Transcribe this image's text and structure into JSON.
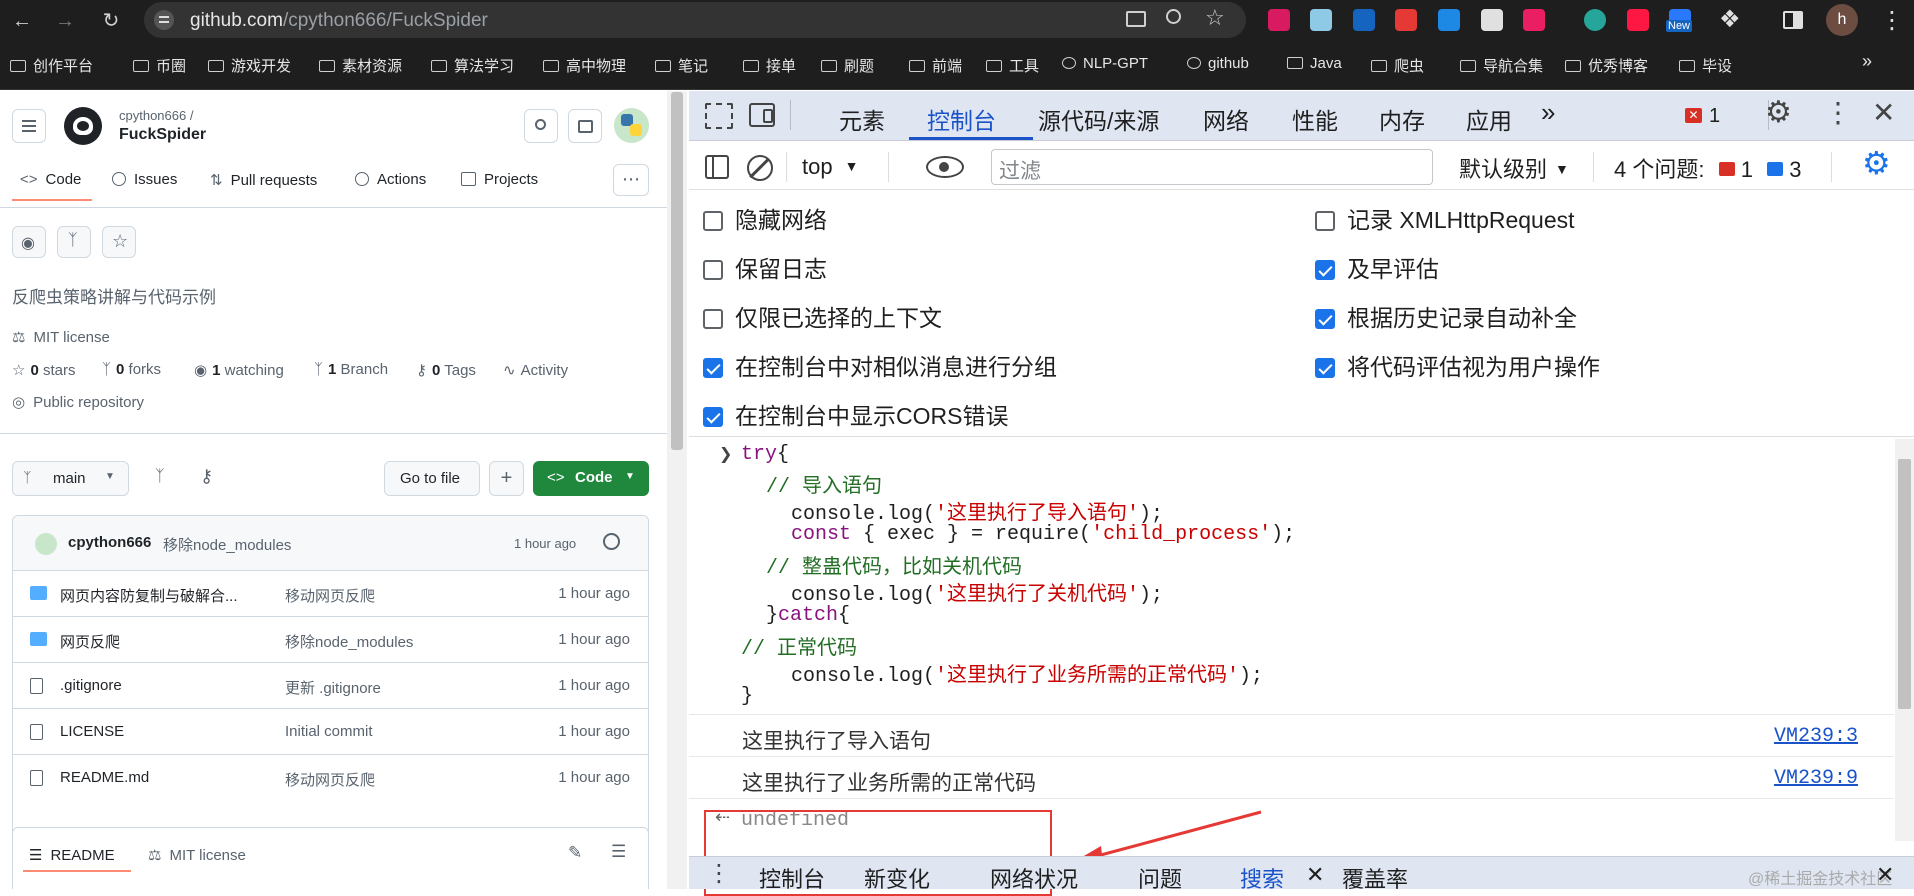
{
  "browser": {
    "url_host": "github.com",
    "url_path": "/cpython666/FuckSpider",
    "profile_initial": "h",
    "ext_new_badge": "New",
    "bookmarks": [
      "创作平台",
      "币圈",
      "游戏开发",
      "素材资源",
      "算法学习",
      "高中物理",
      "笔记",
      "接单",
      "刷题",
      "前端",
      "工具",
      "NLP-GPT",
      "github",
      "Java",
      "爬虫",
      "导航合集",
      "优秀博客",
      "毕设"
    ]
  },
  "github": {
    "owner": "cpython666 /",
    "repo": "FuckSpider",
    "tabs": [
      "Code",
      "Issues",
      "Pull requests",
      "Actions",
      "Projects"
    ],
    "description": "反爬虫策略讲解与代码示例",
    "license": "MIT license",
    "stars": "0",
    "stars_label": "stars",
    "forks": "0",
    "forks_label": "forks",
    "watching": "1",
    "watching_label": "watching",
    "branch_count": "1",
    "branch_label": "Branch",
    "tags": "0",
    "tags_label": "Tags",
    "activity": "Activity",
    "visibility": "Public repository",
    "branch": "main",
    "go_to_file": "Go to file",
    "add": "+",
    "code_btn": "Code",
    "commit_author": "cpython666",
    "commit_msg": "移除node_modules",
    "commit_time": "1 hour ago",
    "files": [
      {
        "name": "网页内容防复制与破解合...",
        "msg": "移动网页反爬",
        "time": "1 hour ago",
        "type": "folder"
      },
      {
        "name": "网页反爬",
        "msg": "移除node_modules",
        "time": "1 hour ago",
        "type": "folder"
      },
      {
        "name": ".gitignore",
        "msg": "更新 .gitignore",
        "time": "1 hour ago",
        "type": "file"
      },
      {
        "name": "LICENSE",
        "msg": "Initial commit",
        "time": "1 hour ago",
        "type": "file"
      },
      {
        "name": "README.md",
        "msg": "移动网页反爬",
        "time": "1 hour ago",
        "type": "file"
      }
    ],
    "readme_tab": "README",
    "readme_license_tab": "MIT license"
  },
  "devtools": {
    "tabs": [
      "元素",
      "控制台",
      "源代码/来源",
      "网络",
      "性能",
      "内存",
      "应用"
    ],
    "error_count": "1",
    "context": "top",
    "filter_placeholder": "过滤",
    "level": "默认级别",
    "issues_label": "4 个问题:",
    "issues_errors": "1",
    "issues_info": "3",
    "settings_left": [
      {
        "label": "隐藏网络",
        "checked": false
      },
      {
        "label": "保留日志",
        "checked": false
      },
      {
        "label": "仅限已选择的上下文",
        "checked": false
      },
      {
        "label": "在控制台中对相似消息进行分组",
        "checked": true
      },
      {
        "label": "在控制台中显示CORS错误",
        "checked": true
      }
    ],
    "settings_right": [
      {
        "label": "记录 XMLHttpRequest",
        "checked": false
      },
      {
        "label": "及早评估",
        "checked": true
      },
      {
        "label": "根据历史记录自动补全",
        "checked": true
      },
      {
        "label": "将代码评估视为用户操作",
        "checked": true
      }
    ],
    "code": {
      "l1_kw": "try",
      "l1_rest": "{",
      "l2": "// 导入语句",
      "l3_a": "console.log(",
      "l3_s": "'这里执行了导入语句'",
      "l3_b": ");",
      "l4_kw": "const",
      "l4_a": " { exec } = require(",
      "l4_s": "'child_process'",
      "l4_b": ");",
      "l5": "// 整蛊代码，比如关机代码",
      "l6_a": "console.log(",
      "l6_s": "'这里执行了关机代码'",
      "l6_b": ");",
      "l7_a": "}",
      "l7_kw": "catch",
      "l7_b": "{",
      "l8": "// 正常代码",
      "l9_a": "console.log(",
      "l9_s": "'这里执行了业务所需的正常代码'",
      "l9_b": ");",
      "l10": "}"
    },
    "logs": [
      {
        "text": "这里执行了导入语句",
        "src": "VM239:3"
      },
      {
        "text": "这里执行了业务所需的正常代码",
        "src": "VM239:9"
      }
    ],
    "result": "undefined",
    "drawer_tabs": [
      "控制台",
      "新变化",
      "网络状况",
      "问题",
      "搜索",
      "覆盖率"
    ],
    "watermark": "@稀土掘金技术社区",
    "highlight_color": "#e53935"
  }
}
